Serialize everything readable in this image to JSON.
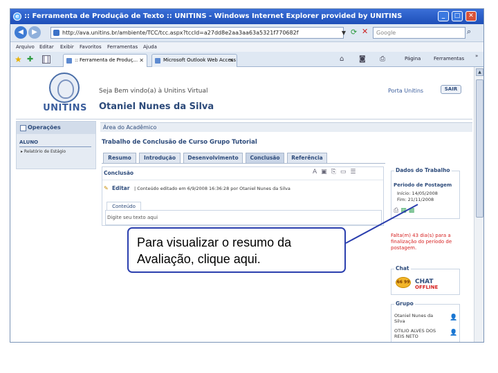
{
  "browser": {
    "title": ":: Ferramenta de Produção de Texto :: UNITINS - Windows Internet Explorer provided by UNITINS",
    "address": "http://ava.unitins.br/ambiente/TCC/tcc.aspx?tccId=a27dd8e2aa3aa63a5321f770682f",
    "search_placeholder": "Google",
    "menu": [
      "Arquivo",
      "Editar",
      "Exibir",
      "Favoritos",
      "Ferramentas",
      "Ajuda"
    ],
    "tabs": [
      {
        "label": ":: Ferramenta de Produç..."
      },
      {
        "label": "Microsoft Outlook Web Access"
      }
    ],
    "toolbar_pagina": "Página",
    "toolbar_ferramentas": "Ferramentas"
  },
  "header": {
    "logo_text": "UNITINS",
    "welcome": "Seja Bem vindo(a) à Unitins Virtual",
    "username": "Otaniel Nunes da Silva",
    "portal_link": "Porta  Unitins",
    "logout_label": "SAIR"
  },
  "sidebar": {
    "heading": "Operações",
    "role": "ALUNO",
    "item": "▸ Relatório de Estágio"
  },
  "main": {
    "area_heading": "Área do Acadêmico",
    "title": "Trabalho de Conclusão de Curso   Grupo Tutorial",
    "tabs": [
      {
        "label": "Resumo"
      },
      {
        "label": "Introdução"
      },
      {
        "label": "Desenvolvimento"
      },
      {
        "label": "Conclusão"
      },
      {
        "label": "Referência"
      }
    ],
    "section_title": "Conclusão",
    "edit_label": "Editar",
    "edit_info": "| Conteúdo editado em 6/9/2008 16:36:28 por Otaniel Nunes da Silva",
    "content_label": "Conteúdo",
    "content_placeholder": "Digite seu texto aqui"
  },
  "right": {
    "dados_title": "Dados do Trabalho",
    "periodo_label": "Periodo de Postagem",
    "inicio": "Início: 14/05/2008",
    "fim": "Fim: 21/11/2008",
    "falta_text": "Falta(m) 43 dia(s) para a finalização do período de postagem.",
    "chat_title": "Chat",
    "chat_bubble": "66 99",
    "chat_word": "CHAT",
    "chat_status": "OFFLINE",
    "grupo_title": "Grupo",
    "members": [
      {
        "name": "Otaniel Nunes da Silva"
      },
      {
        "name": "OTILIO ALVES DOS REIS NETO"
      }
    ]
  },
  "callout": {
    "text": "Para visualizar o resumo da Avaliação, clique aqui."
  }
}
